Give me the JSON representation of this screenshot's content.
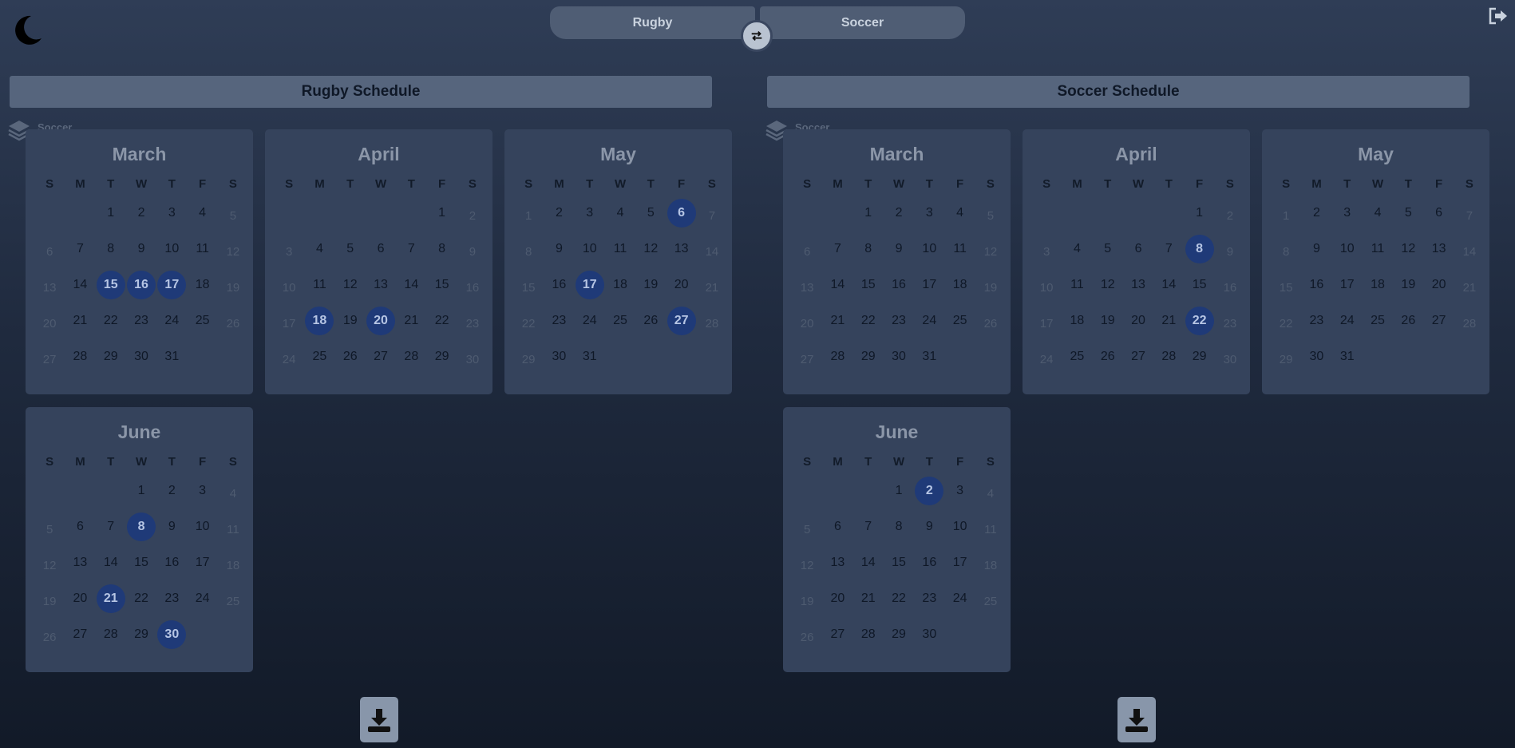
{
  "tabs": {
    "left": "Rugby",
    "right": "Soccer"
  },
  "icons": {
    "theme": "moon-icon",
    "logout": "logout-icon",
    "swap": "swap-arrows-icon",
    "layers": "layers-icon",
    "download": "download-icon"
  },
  "highlight_color": "#1f3a78",
  "schedules": [
    {
      "title": "Rugby Schedule",
      "layer_label": "Soccer",
      "months": [
        {
          "name": "March",
          "start": 2,
          "days": 31,
          "highlighted": [
            15,
            16,
            17
          ]
        },
        {
          "name": "April",
          "start": 5,
          "days": 30,
          "highlighted": [
            18,
            20
          ]
        },
        {
          "name": "May",
          "start": 0,
          "days": 31,
          "highlighted": [
            6,
            17,
            27
          ]
        },
        {
          "name": "June",
          "start": 3,
          "days": 30,
          "highlighted": [
            8,
            21,
            30
          ]
        }
      ]
    },
    {
      "title": "Soccer Schedule",
      "layer_label": "Soccer",
      "months": [
        {
          "name": "March",
          "start": 2,
          "days": 31,
          "highlighted": []
        },
        {
          "name": "April",
          "start": 5,
          "days": 30,
          "highlighted": [
            8,
            22
          ]
        },
        {
          "name": "May",
          "start": 0,
          "days": 31,
          "highlighted": []
        },
        {
          "name": "June",
          "start": 3,
          "days": 30,
          "highlighted": [
            2
          ]
        }
      ]
    }
  ],
  "weekday_labels": [
    "S",
    "M",
    "T",
    "W",
    "T",
    "F",
    "S"
  ]
}
